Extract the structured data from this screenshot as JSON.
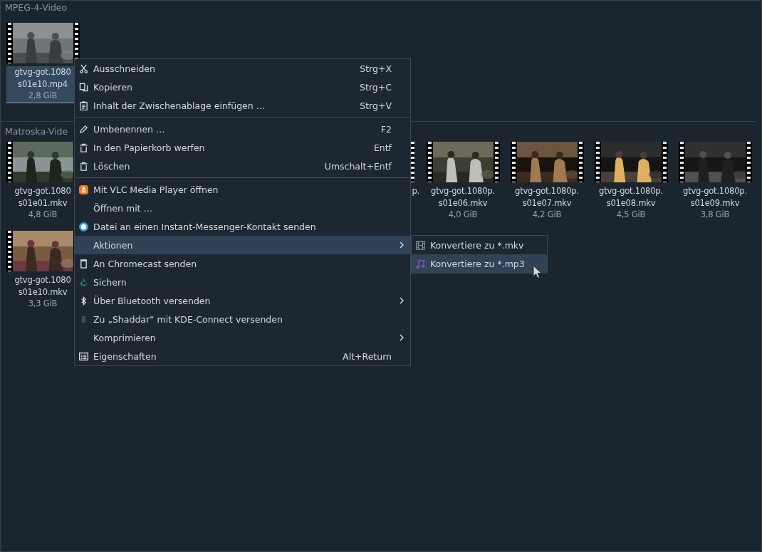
{
  "sections": [
    {
      "title": "MPEG-4-Video",
      "files": [
        {
          "kind": "tile",
          "lines": [
            "gtvg-got.1080",
            "s01e10.mp4"
          ],
          "size": "2,8 GiB",
          "selected": true
        }
      ]
    },
    {
      "title": "Matroska-Vide",
      "files": [
        {
          "kind": "tile",
          "lines": [
            "gtvg-got.1080",
            "s01e01.mkv"
          ],
          "size": "4,8 GiB",
          "selected": false
        },
        {
          "kind": "covered"
        },
        {
          "kind": "covered"
        },
        {
          "kind": "covered"
        },
        {
          "kind": "partial",
          "lines": [
            "p."
          ],
          "selected": false
        },
        {
          "kind": "tile",
          "lines": [
            "gtvg-got.1080p.",
            "s01e06.mkv"
          ],
          "size": "4,0 GiB",
          "selected": false
        },
        {
          "kind": "tile",
          "lines": [
            "gtvg-got.1080p.",
            "s01e07.mkv"
          ],
          "size": "4,2 GiB",
          "selected": false
        },
        {
          "kind": "tile",
          "lines": [
            "gtvg-got.1080p.",
            "s01e08.mkv"
          ],
          "size": "4,5 GiB",
          "selected": false
        },
        {
          "kind": "tile",
          "lines": [
            "gtvg-got.1080p.",
            "s01e09.mkv"
          ],
          "size": "3,8 GiB",
          "selected": false
        },
        {
          "kind": "tile",
          "lines": [
            "gtvg-got.1080",
            "s01e10.mkv"
          ],
          "size": "3,3 GiB",
          "selected": false
        }
      ]
    }
  ],
  "context_menu": [
    {
      "kind": "item",
      "label": "Ausschneiden",
      "shortcut": "Strg+X",
      "submenu": false,
      "selected": false
    },
    {
      "kind": "item",
      "label": "Kopieren",
      "shortcut": "Strg+C",
      "submenu": false,
      "selected": false
    },
    {
      "kind": "item",
      "label": "Inhalt der Zwischenablage einfügen …",
      "shortcut": "Strg+V",
      "submenu": false,
      "selected": false
    },
    {
      "kind": "separator"
    },
    {
      "kind": "item",
      "label": "Umbenennen …",
      "shortcut": "F2",
      "submenu": false,
      "selected": false
    },
    {
      "kind": "item",
      "label": "In den Papierkorb werfen",
      "shortcut": "Entf",
      "submenu": false,
      "selected": false
    },
    {
      "kind": "item",
      "label": "Löschen",
      "shortcut": "Umschalt+Entf",
      "submenu": false,
      "selected": false
    },
    {
      "kind": "separator"
    },
    {
      "kind": "item",
      "label": "Mit VLC Media Player öffnen",
      "submenu": false,
      "selected": false
    },
    {
      "kind": "item",
      "label": "Öffnen mit …",
      "submenu": false,
      "selected": false
    },
    {
      "kind": "item",
      "label": "Datei an einen Instant-Messenger-Kontakt senden",
      "submenu": false,
      "selected": false
    },
    {
      "kind": "item",
      "label": "Aktionen",
      "submenu": true,
      "selected": true
    },
    {
      "kind": "item",
      "label": "An Chromecast senden",
      "submenu": false,
      "selected": false
    },
    {
      "kind": "item",
      "label": "Sichern",
      "submenu": false,
      "selected": false
    },
    {
      "kind": "item",
      "label": "Über Bluetooth versenden",
      "submenu": true,
      "selected": false
    },
    {
      "kind": "item",
      "label": "Zu „Shaddar“ mit KDE-Connect versenden",
      "submenu": false,
      "selected": false
    },
    {
      "kind": "item",
      "label": "Komprimieren",
      "submenu": true,
      "selected": false
    },
    {
      "kind": "item",
      "label": "Eigenschaften",
      "shortcut": "Alt+Return",
      "submenu": false,
      "selected": false
    }
  ],
  "submenu": [
    {
      "label": "Konvertiere zu *.mkv",
      "selected": false
    },
    {
      "label": "Konvertiere zu *.mp3",
      "selected": true
    }
  ]
}
